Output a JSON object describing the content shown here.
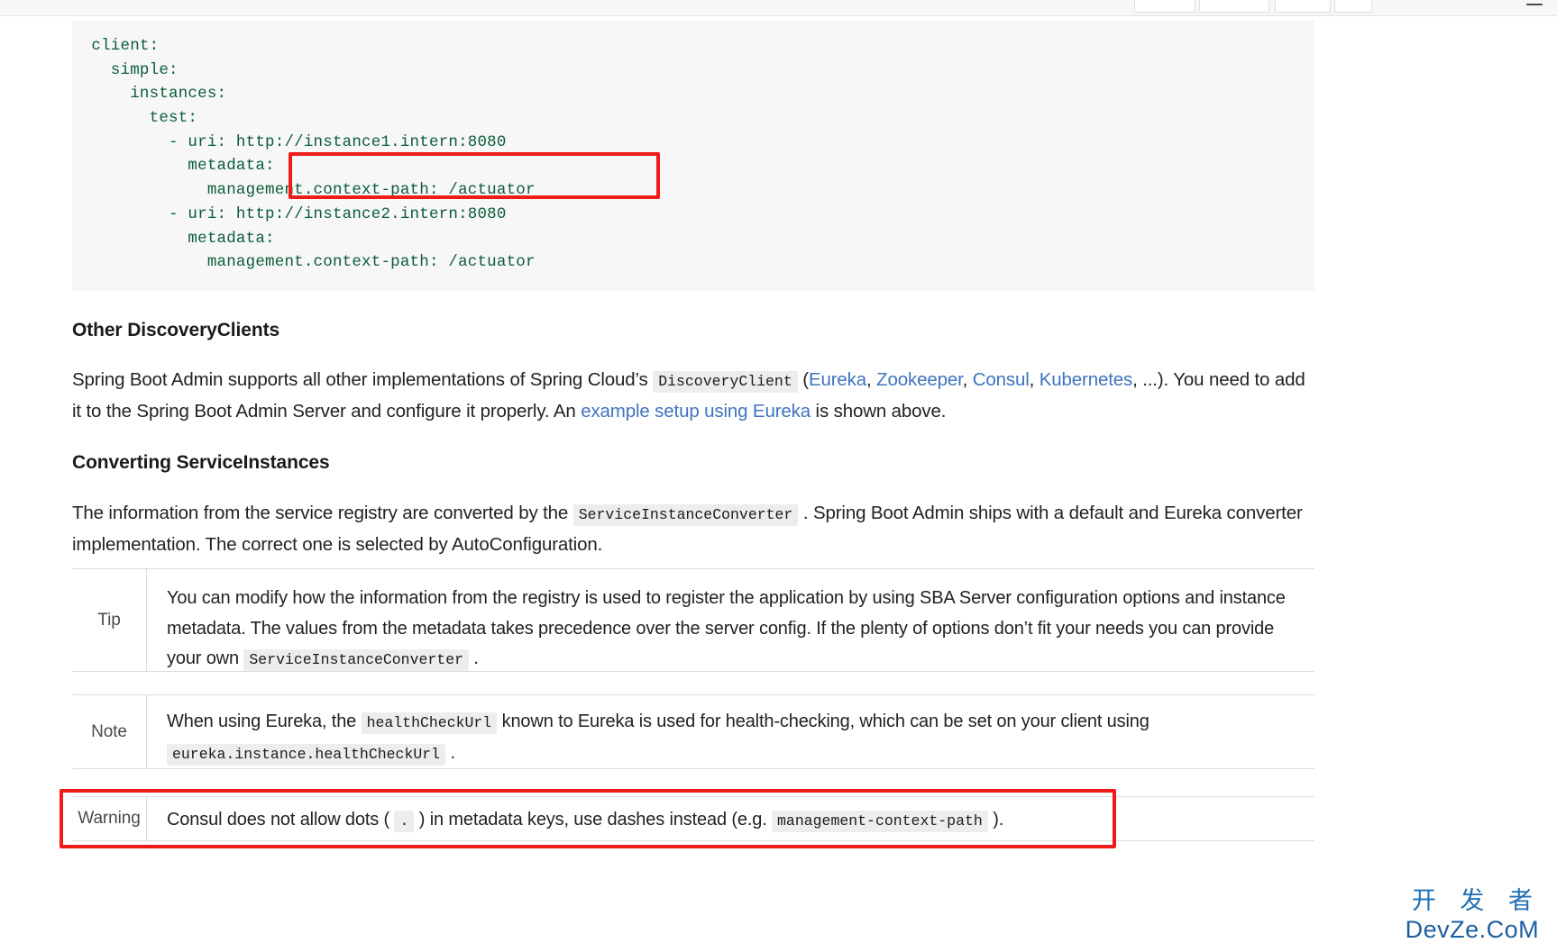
{
  "browser": {
    "menu_icon": "hamburger-menu-icon"
  },
  "code_block": {
    "language": "yaml",
    "text_color": "#0b5c3a",
    "background": "#f6f7f6",
    "lines": [
      "  client:",
      "    simple:",
      "      instances:",
      "        test:",
      "          - uri: http://instance1.intern:8080",
      "            metadata:",
      "              management.context-path: /actuator",
      "          - uri: http://instance2.intern:8080",
      "            metadata:",
      "              management.context-path: /actuator"
    ],
    "highlight_color": "#ee1b18"
  },
  "sections": {
    "other_discovery_clients": {
      "heading": "Other DiscoveryClients",
      "paragraph": {
        "part1": "Spring Boot Admin supports all other implementations of Spring Cloud’s ",
        "code1": "DiscoveryClient",
        "part2": " (",
        "links": [
          {
            "label": "Eureka"
          },
          {
            "label": "Zookeeper"
          },
          {
            "label": "Consul"
          },
          {
            "label": "Kubernetes"
          }
        ],
        "link_separator": ", ",
        "part3": ", ...). You need to add it to the Spring Boot Admin Server and configure it properly. An ",
        "link_example": "example setup using Eureka",
        "part4": " is shown above."
      }
    },
    "converting_service_instances": {
      "heading": "Converting ServiceInstances",
      "paragraph": {
        "part1": "The information from the service registry are converted by the ",
        "code1": "ServiceInstanceConverter",
        "part2": " . Spring Boot Admin ships with a default and Eureka converter implementation. The correct one is selected by AutoConfiguration."
      }
    }
  },
  "admonitions": [
    {
      "label": "Tip",
      "text_part1": "You can modify how the information from the registry is used to register the application by using SBA Server configuration options and instance metadata. The values from the metadata takes precedence over the server config. If the plenty of options don’t fit your needs you can provide your own ",
      "code1": "ServiceInstanceConverter",
      "text_part2": " ."
    },
    {
      "label": "Note",
      "text_part1": "When using Eureka, the ",
      "code1": "healthCheckUrl",
      "text_part2": " known to Eureka is used for health-checking, which can be set on your client using ",
      "code2": "eureka.instance.healthCheckUrl",
      "text_part3": " ."
    },
    {
      "label": "Warning",
      "text_part1": "Consul does not allow dots ( ",
      "code1": ".",
      "text_part2": " ) in metadata keys, use dashes instead (e.g. ",
      "code2": "management-context-path",
      "text_part3": " )."
    }
  ],
  "watermark": {
    "chinese": "开 发 者",
    "latin": "DevZe.CoM",
    "color": "#2171b5"
  }
}
